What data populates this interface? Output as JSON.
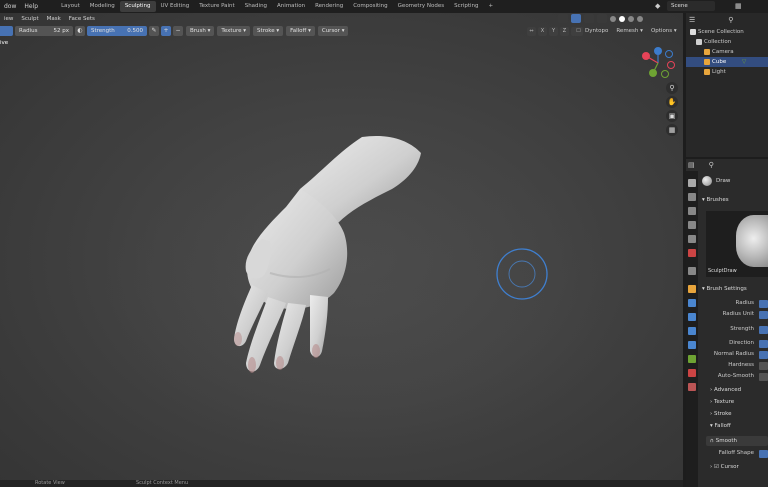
{
  "menubar": {
    "items": [
      "dow",
      "Help"
    ]
  },
  "workspaces": [
    "Layout",
    "Modeling",
    "Sculpting",
    "UV Editing",
    "Texture Paint",
    "Shading",
    "Animation",
    "Rendering",
    "Compositing",
    "Geometry Nodes",
    "Scripting"
  ],
  "active_workspace": "Sculpting",
  "scene": {
    "name": "Scene"
  },
  "viewport_menu": [
    "iew",
    "Sculpt",
    "Mask",
    "Face Sets"
  ],
  "tool_header": {
    "radius_label": "Radius",
    "radius_value": "52 px",
    "strength_label": "Strength",
    "strength_value": "0.500",
    "plus": "+",
    "minus": "−",
    "dropdowns": [
      "Brush",
      "Texture",
      "Stroke",
      "Falloff",
      "Cursor"
    ]
  },
  "symmetry": [
    "X",
    "Y",
    "Z"
  ],
  "remesh": {
    "dyntopo": "Dyntopo",
    "remesh": "Remesh",
    "options": "Options"
  },
  "view_label": "ive",
  "outliner": {
    "title": "Scene Collection",
    "rows": [
      {
        "label": "Collection",
        "color": "#cfcfcf",
        "indent": 1
      },
      {
        "label": "Camera",
        "color": "#e8a53c",
        "indent": 2
      },
      {
        "label": "Cube",
        "color": "#e8a53c",
        "indent": 2,
        "selected": true
      },
      {
        "label": "Light",
        "color": "#e8a53c",
        "indent": 2
      }
    ]
  },
  "properties": {
    "brush_name": "Draw",
    "brushes_section": "Brushes",
    "brush_preview_name": "SculptDraw",
    "brush_settings": "Brush Settings",
    "rows": [
      "Radius",
      "Radius Unit",
      "Strength",
      "Direction",
      "Normal Radius",
      "Hardness",
      "Auto-Smooth"
    ],
    "subsections": [
      "Advanced",
      "Texture",
      "Stroke",
      "Falloff"
    ],
    "falloff_preset": "Smooth",
    "falloff_shape": "Falloff Shape",
    "cursor": "Cursor"
  },
  "status": {
    "left": "Rotate View",
    "mid": "Sculpt Context Menu"
  },
  "colors": {
    "accent": "#4772b3",
    "selection": "#334d80",
    "gizmo_x": "#e64358",
    "gizmo_y": "#6ea333",
    "gizmo_z": "#3c7ccc"
  }
}
